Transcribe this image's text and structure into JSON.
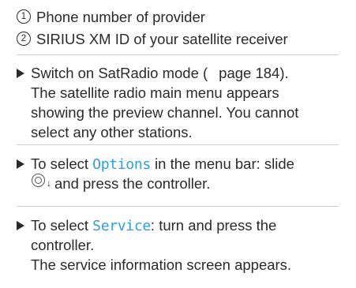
{
  "legend": [
    {
      "number": "1",
      "text": "Phone number of provider"
    },
    {
      "number": "2",
      "text": "SIRIUS XM ID of your satellite receiver"
    }
  ],
  "steps": {
    "step1": {
      "line1_a": "Switch on SatRadio mode (",
      "line1_page_ref": "page 184).",
      "line2": "The satellite radio main menu appears",
      "line3": "showing the preview channel. You cannot",
      "line4": "select any other stations."
    },
    "step2": {
      "prefix": "To select ",
      "term": "Options",
      "suffix": " in the menu bar: slide",
      "line2_suffix": " and press the controller."
    },
    "step3": {
      "prefix": "To select ",
      "term": "Service",
      "suffix": ": turn and press the",
      "line2": "controller.",
      "line3": "The service information screen appears."
    }
  },
  "icons": {
    "bullet": "right-triangle-icon",
    "page_reference": "page-reference-triangle-icon",
    "controller": "controller-icon",
    "slide_down": "slide-down-arrow-icon",
    "slide_down_glyph": "↓"
  },
  "colors": {
    "text": "#2a2a2a",
    "term": "#2f9fd8",
    "divider": "#cfcfcf"
  }
}
